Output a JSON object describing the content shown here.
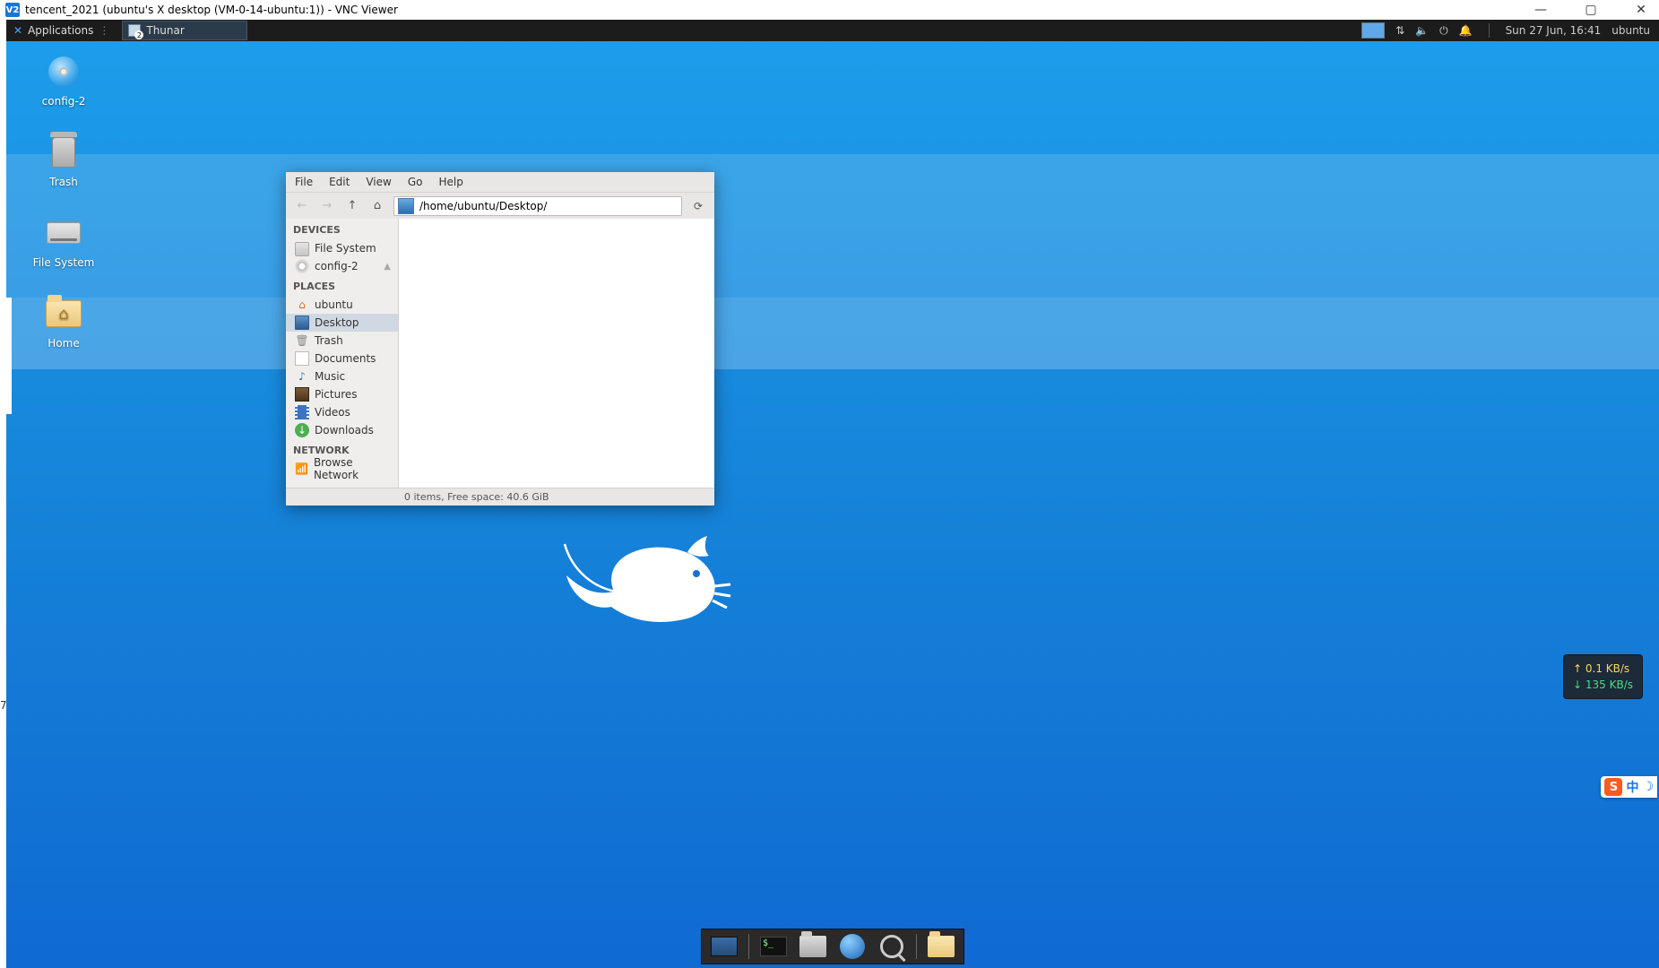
{
  "vnc": {
    "title": "tencent_2021 (ubuntu's X desktop (VM-0-14-ubuntu:1)) - VNC Viewer"
  },
  "panel": {
    "applications": "Applications",
    "task_app": "Thunar",
    "datetime": "Sun 27 Jun, 16:41",
    "session": "ubuntu"
  },
  "desktop_icons": {
    "config2": "config-2",
    "trash": "Trash",
    "filesystem": "File System",
    "home": "Home"
  },
  "thunar": {
    "menus": {
      "file": "File",
      "edit": "Edit",
      "view": "View",
      "go": "Go",
      "help": "Help"
    },
    "path": "/home/ubuntu/Desktop/",
    "sidebar": {
      "devices_hdr": "DEVICES",
      "filesystem": "File System",
      "config2": "config-2",
      "places_hdr": "PLACES",
      "ubuntu": "ubuntu",
      "desktop": "Desktop",
      "trash": "Trash",
      "documents": "Documents",
      "music": "Music",
      "pictures": "Pictures",
      "videos": "Videos",
      "downloads": "Downloads",
      "network_hdr": "NETWORK",
      "browse_network": "Browse Network"
    },
    "status": "0 items, Free space: 40.6 GiB"
  },
  "netspeed": {
    "up": "↑ 0.1 KB/s",
    "down": "↓ 135 KB/s"
  },
  "ime": {
    "s": "S",
    "c": "中",
    "m": "☽"
  },
  "seven": "7"
}
